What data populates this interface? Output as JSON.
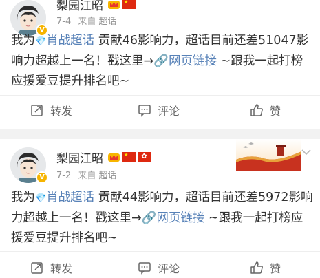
{
  "posts": [
    {
      "author": "梨园江昭",
      "date": "7-4",
      "source": "来自 超话",
      "text_before_topic": "我为",
      "topic": "肖战超话",
      "text_after_topic": " 贡献46影响力，超话目前还差51047影响力超越上一名！戳这里→",
      "link_text": "网页链接",
      "text_after_link": " ~跟我一起打榜应援爱豆提升排名吧~",
      "actions": {
        "repost": "转发",
        "comment": "评论",
        "like": "赞"
      }
    },
    {
      "author": "梨园江昭",
      "date": "7-2",
      "source": "来自 超话",
      "text_before_topic": "我为",
      "topic": "肖战超话",
      "text_after_topic": " 贡献44影响力，超话目前还差5972影响力超越上一名！戳这里→",
      "link_text": "网页链接",
      "text_after_link": " ~跟我一起打榜应援爱豆提升排名吧~",
      "actions": {
        "repost": "转发",
        "comment": "评论",
        "like": "赞"
      }
    }
  ],
  "icons": {
    "repost": "repost-icon",
    "comment": "comment-icon",
    "like": "thumbs-up-icon",
    "verified": "verified-badge-icon",
    "crown": "crown-badge-icon",
    "flag_cn": "china-flag-icon",
    "flag_hk": "hong-kong-flag-icon",
    "link": "link-icon",
    "topic": "diamond-icon",
    "expand": "chevron-down-icon"
  },
  "colors": {
    "link_blue": "#5882b8",
    "text": "#333333",
    "meta_gray": "#939393",
    "action_gray": "#666666",
    "background": "#f2f2f2"
  }
}
